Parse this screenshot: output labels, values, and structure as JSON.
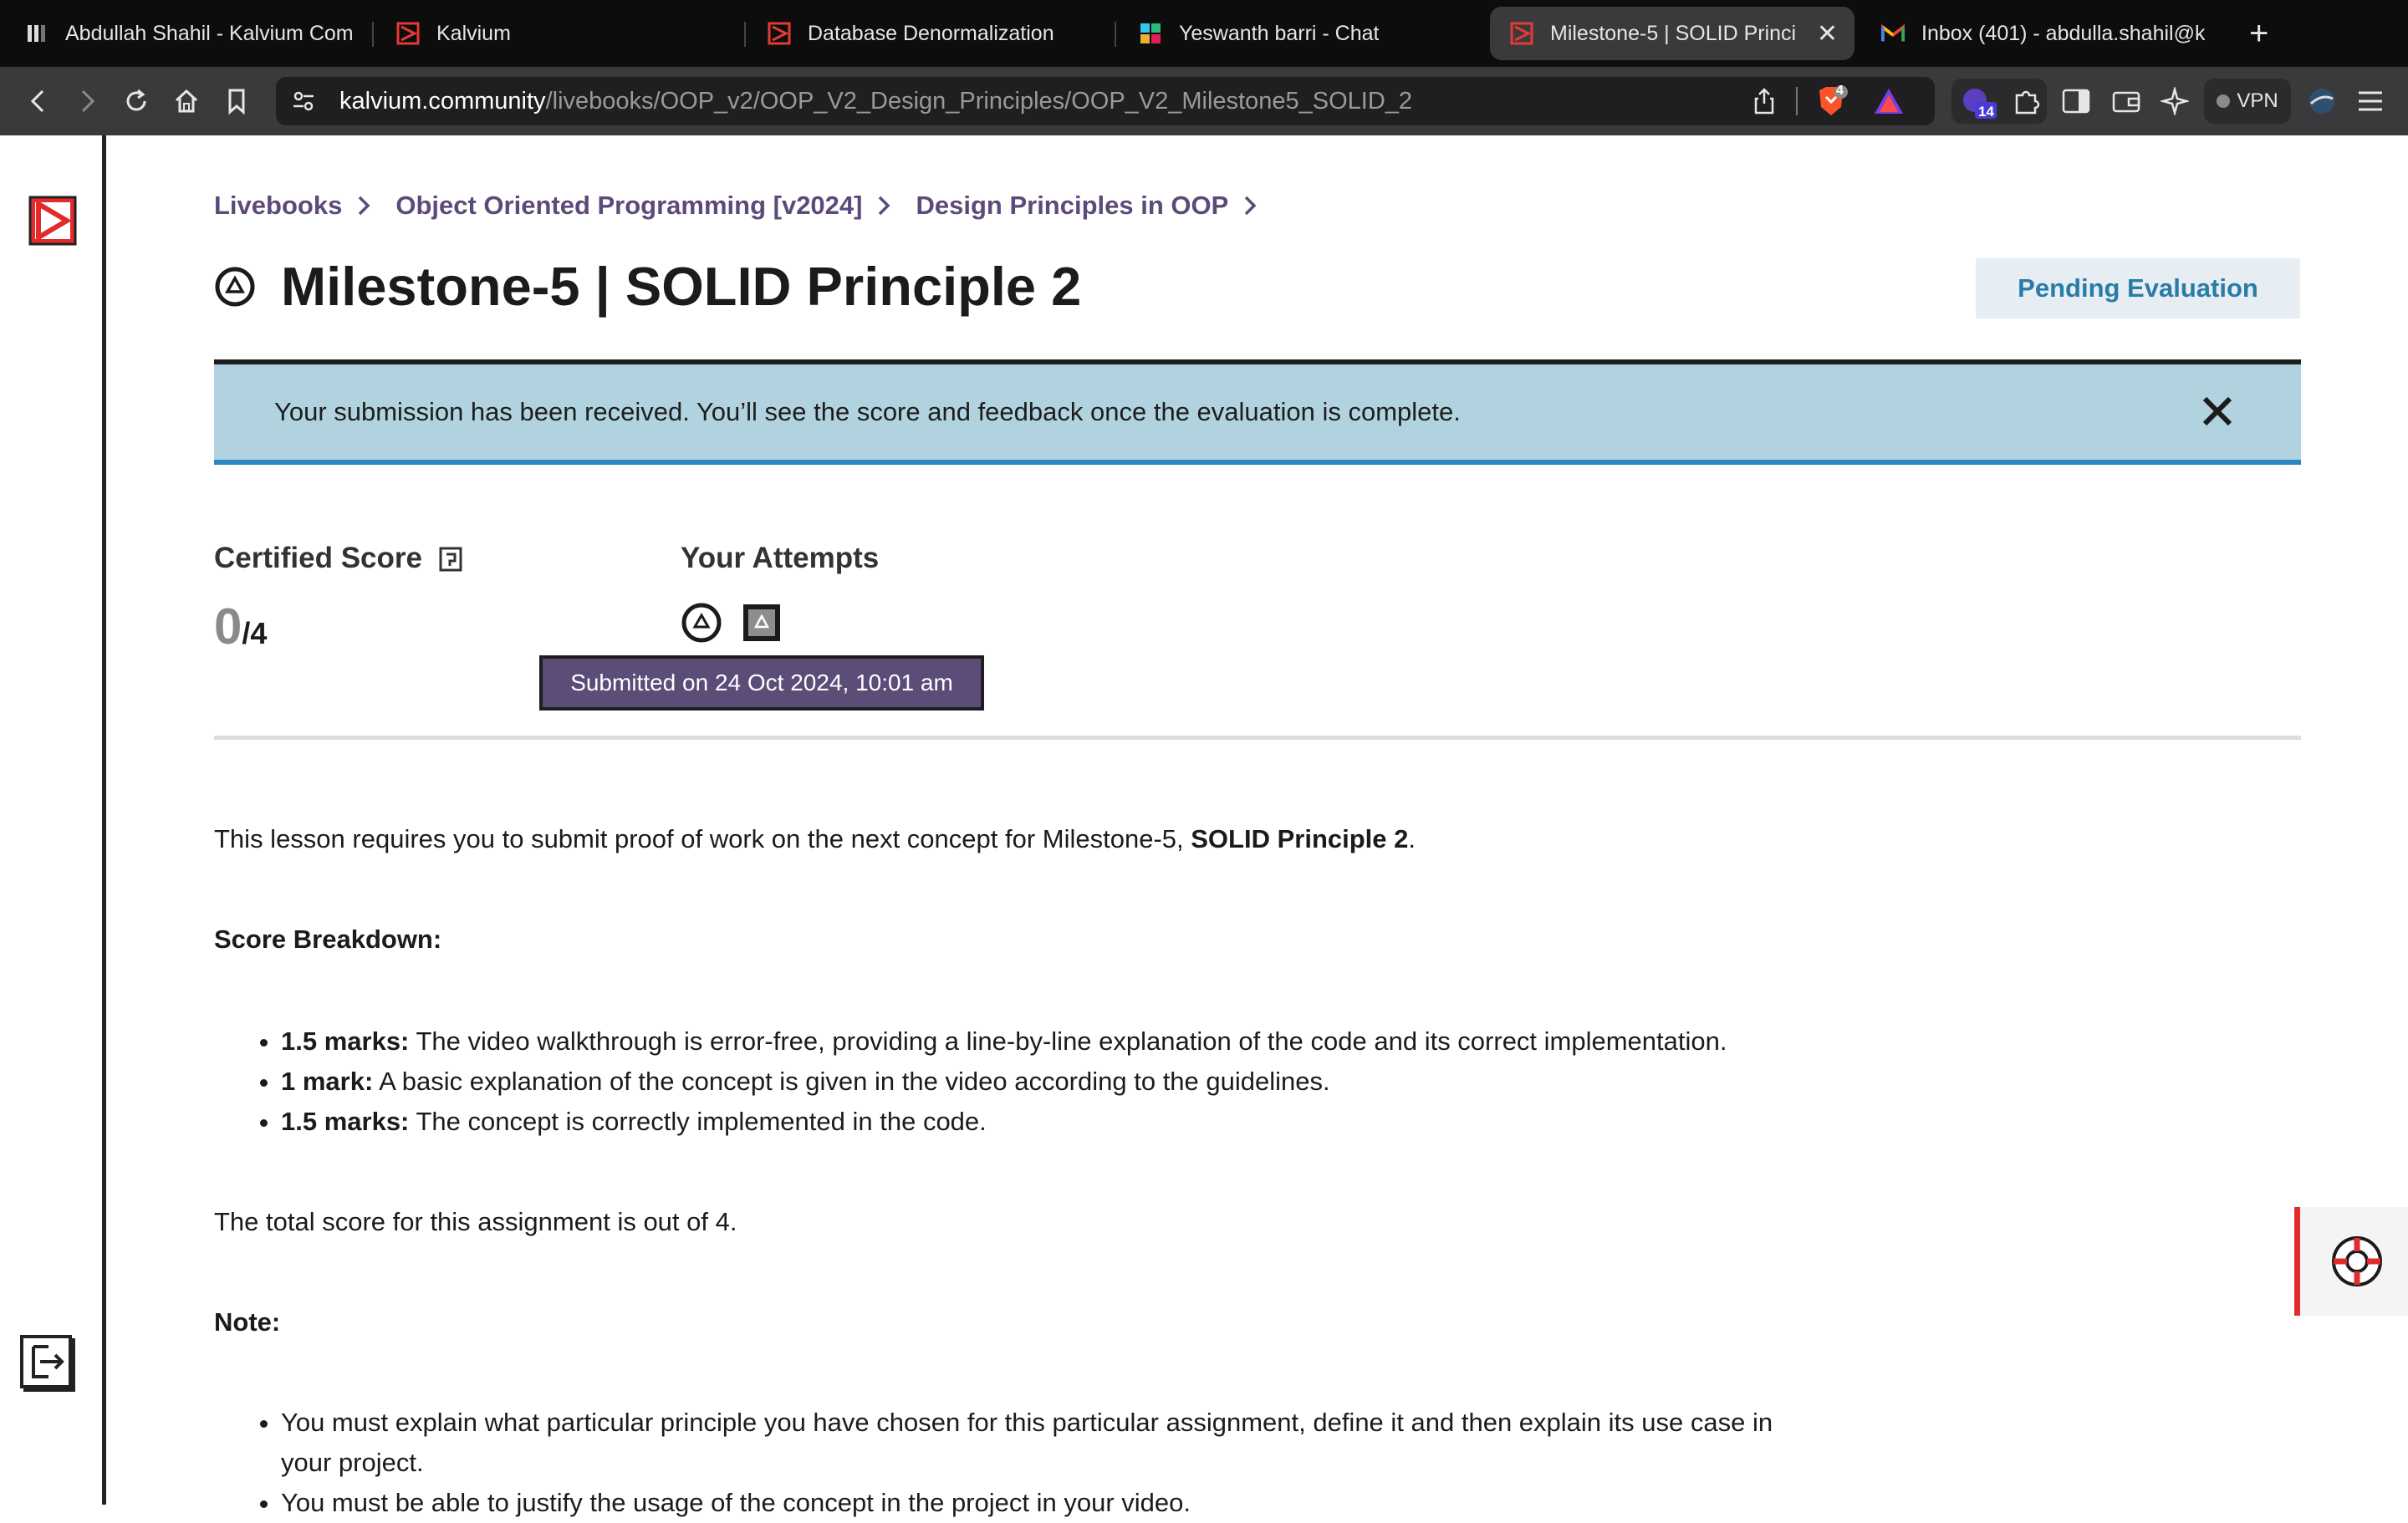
{
  "browser": {
    "tabs": [
      {
        "title": "Abdullah Shahil - Kalvium Com",
        "icon": "kalvium-community-icon"
      },
      {
        "title": "Kalvium",
        "icon": "kalvium-logo-icon"
      },
      {
        "title": "Database Denormalization",
        "icon": "kalvium-logo-icon"
      },
      {
        "title": "Yeswanth barri - Chat",
        "icon": "chat-app-icon"
      },
      {
        "title": "Milestone-5 | SOLID Princi",
        "icon": "kalvium-logo-icon",
        "active": true
      },
      {
        "title": "Inbox (401) - abdulla.shahil@k",
        "icon": "gmail-icon"
      }
    ],
    "url_host": "kalvium.community",
    "url_path": "/livebooks/OOP_v2/OOP_V2_Design_Principles/OOP_V2_Milestone5_SOLID_2",
    "brave_badge": "4",
    "extension_badge": "14",
    "vpn_label": "VPN"
  },
  "breadcrumb": [
    "Livebooks",
    "Object Oriented Programming [v2024]",
    "Design Principles in OOP"
  ],
  "page_title": "Milestone-5 | SOLID Principle 2",
  "status_badge": "Pending Evaluation",
  "banner_text": "Your submission has been received. You’ll see the score and feedback once the evaluation is complete.",
  "score": {
    "label": "Certified Score",
    "value": "0",
    "total": "/4"
  },
  "attempts": {
    "label": "Your Attempts",
    "tooltip": "Submitted on 24 Oct 2024, 10:01 am"
  },
  "lesson": {
    "intro_prefix": "This lesson requires you to submit proof of work on the next concept for Milestone-5, ",
    "intro_bold": "SOLID Principle 2",
    "intro_suffix": ".",
    "breakdown_heading": "Score Breakdown:",
    "breakdown": [
      {
        "bold": "1.5 marks:",
        "text": " The video walkthrough is error-free, providing a line-by-line explanation of the code and its correct implementation."
      },
      {
        "bold": "1 mark:",
        "text": " A basic explanation of the concept is given in the video according to the guidelines."
      },
      {
        "bold": "1.5 marks:",
        "text": " The concept is correctly implemented in the code."
      }
    ],
    "total_text": "The total score for this assignment is out of 4.",
    "note_heading": "Note:",
    "notes": [
      "You must explain what particular principle you have chosen for this particular assignment, define it and then explain its use case in",
      "your project.",
      "You must be able to justify the usage of the concept in the project in your video."
    ]
  },
  "colors": {
    "accent_purple": "#5c4a7a",
    "banner_bg": "#b1d3e0",
    "banner_border": "#2b86bf",
    "badge_text": "#2a7ca6",
    "brand_red": "#e32b2b"
  }
}
